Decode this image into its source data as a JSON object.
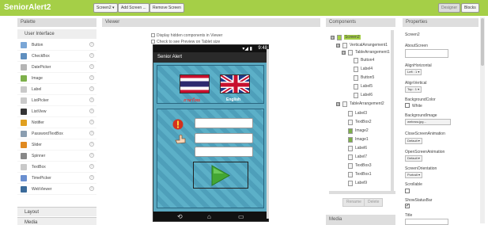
{
  "app": {
    "title": "SeniorAlert2",
    "screen_select": "Screen2 ▾",
    "add_screen": "Add Screen ...",
    "remove_screen": "Remove Screen",
    "designer": "Designer",
    "blocks": "Blocks"
  },
  "palette": {
    "title": "Palette",
    "section": "User Interface",
    "help_glyph": "?",
    "items": [
      {
        "label": "Button",
        "color": "#7aa6d6"
      },
      {
        "label": "CheckBox",
        "color": "#5f8fbf"
      },
      {
        "label": "DatePicker",
        "color": "#b5b5b5"
      },
      {
        "label": "Image",
        "color": "#7db04a"
      },
      {
        "label": "Label",
        "color": "#c9c9c9"
      },
      {
        "label": "ListPicker",
        "color": "#c9c9c9"
      },
      {
        "label": "ListView",
        "color": "#333333"
      },
      {
        "label": "Notifier",
        "color": "#e0a020"
      },
      {
        "label": "PasswordTextBox",
        "color": "#8a9db0"
      },
      {
        "label": "Slider",
        "color": "#e08a20"
      },
      {
        "label": "Spinner",
        "color": "#888888"
      },
      {
        "label": "TextBox",
        "color": "#c9c9c9"
      },
      {
        "label": "TimePicker",
        "color": "#6a8fd0"
      },
      {
        "label": "WebViewer",
        "color": "#3a6a9a"
      }
    ],
    "layout_section": "Layout",
    "media_section": "Media"
  },
  "viewer": {
    "title": "Viewer",
    "hidden_components": "Display hidden components in Viewer",
    "tablet_preview": "Check to see Preview on Tablet size",
    "clock": "9:48",
    "signal": "▾◢ ▮",
    "screen_title": "Senior Alert",
    "flag_left_label": "ภาษาไทย",
    "flag_right_label": "English",
    "nav_back": "⟲",
    "nav_home": "⌂",
    "nav_recent": "▭"
  },
  "components": {
    "title": "Components",
    "tree": [
      {
        "label": "Screen2",
        "depth": 0,
        "toggle": "⊟"
      },
      {
        "label": "VerticalArrangement1",
        "depth": 1,
        "toggle": "⊟"
      },
      {
        "label": "TableArrangement1",
        "depth": 2,
        "toggle": "⊟"
      },
      {
        "label": "Button4",
        "depth": 3,
        "toggle": ""
      },
      {
        "label": "Label4",
        "depth": 3,
        "toggle": ""
      },
      {
        "label": "Button5",
        "depth": 3,
        "toggle": ""
      },
      {
        "label": "Label5",
        "depth": 3,
        "toggle": ""
      },
      {
        "label": "Label6",
        "depth": 3,
        "toggle": ""
      },
      {
        "label": "TableArrangement2",
        "depth": 1,
        "toggle": "⊟"
      },
      {
        "label": "Label3",
        "depth": 2,
        "toggle": ""
      },
      {
        "label": "TextBox2",
        "depth": 2,
        "toggle": ""
      },
      {
        "label": "Image2",
        "depth": 2,
        "toggle": ""
      },
      {
        "label": "Image1",
        "depth": 2,
        "toggle": ""
      },
      {
        "label": "Label6",
        "depth": 2,
        "toggle": ""
      },
      {
        "label": "Label7",
        "depth": 2,
        "toggle": ""
      },
      {
        "label": "TextBox3",
        "depth": 2,
        "toggle": ""
      },
      {
        "label": "TextBox1",
        "depth": 2,
        "toggle": ""
      },
      {
        "label": "Label9",
        "depth": 2,
        "toggle": ""
      }
    ],
    "rename": "Rename",
    "delete": "Delete",
    "media": "Media"
  },
  "properties": {
    "title": "Properties",
    "component": "Screen2",
    "about_screen": "AboutScreen",
    "align_horizontal": "AlignHorizontal",
    "align_horizontal_value": "Left : 1 ▾",
    "align_vertical": "AlignVertical",
    "align_vertical_value": "Top : 1 ▾",
    "background_color": "BackgroundColor",
    "background_color_value": "White",
    "background_image": "BackgroundImage",
    "background_image_value": "webxsw.jpg...",
    "close_animation": "CloseScreenAnimation",
    "close_animation_value": "Default ▾",
    "open_animation": "OpenScreenAnimation",
    "open_animation_value": "Default ▾",
    "orientation": "ScreenOrientation",
    "orientation_value": "Portrait ▾",
    "scrollable": "Scrollable",
    "show_status_bar": "ShowStatusBar",
    "title_prop": "Title",
    "check_glyph": "✔"
  },
  "colors": {
    "topbar": "#a5cf47",
    "panel_head": "#dedede"
  }
}
